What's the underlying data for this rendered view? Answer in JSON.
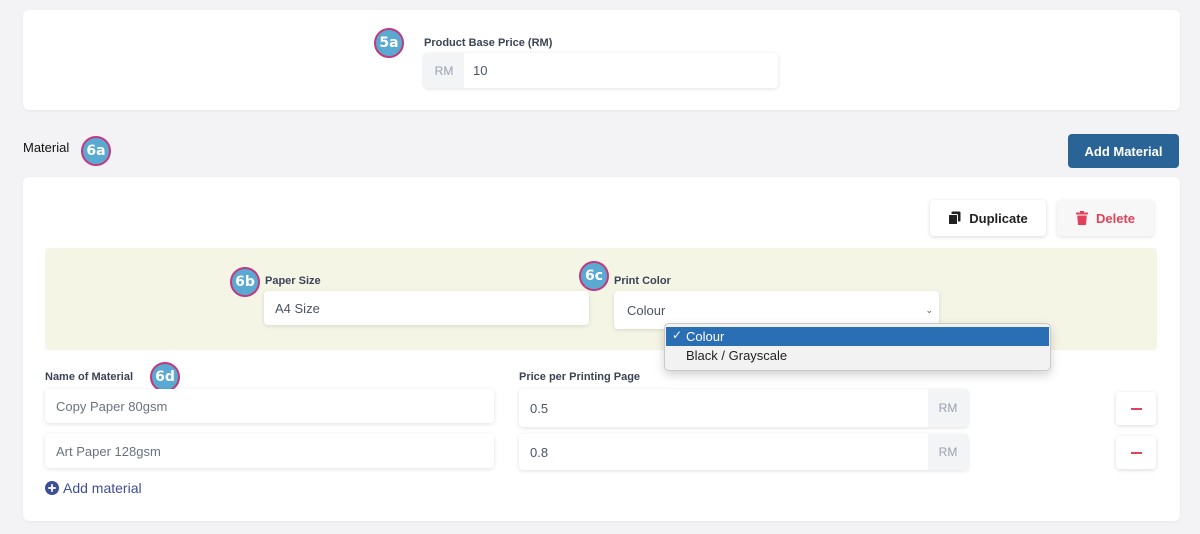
{
  "badges": {
    "b5a": "5a",
    "b6a": "6a",
    "b6b": "6b",
    "b6c": "6c",
    "b6d": "6d"
  },
  "base_price": {
    "label": "Product Base Price (RM)",
    "prefix": "RM",
    "value": "10"
  },
  "material_section": {
    "title": "Material",
    "add_button": "Add Material"
  },
  "material_card": {
    "duplicate": "Duplicate",
    "delete": "Delete",
    "paper_size": {
      "label": "Paper Size",
      "value": "A4 Size"
    },
    "print_color": {
      "label": "Print Color",
      "value": "Colour",
      "options": [
        "Colour",
        "Black / Grayscale"
      ]
    },
    "name_label": "Name of Material",
    "price_label": "Price per Printing Page",
    "rows": [
      {
        "name": "Copy Paper 80gsm",
        "price": "0.5",
        "unit": "RM"
      },
      {
        "name": "Art Paper 128gsm",
        "price": "0.8",
        "unit": "RM"
      }
    ],
    "add_material_link": "Add material"
  },
  "colors": {
    "accent": "#2a6496",
    "delete": "#e0425a",
    "print_panel": "#f5f5e6",
    "badge_fill": "#5aa9d2",
    "badge_border": "#c2387d"
  }
}
